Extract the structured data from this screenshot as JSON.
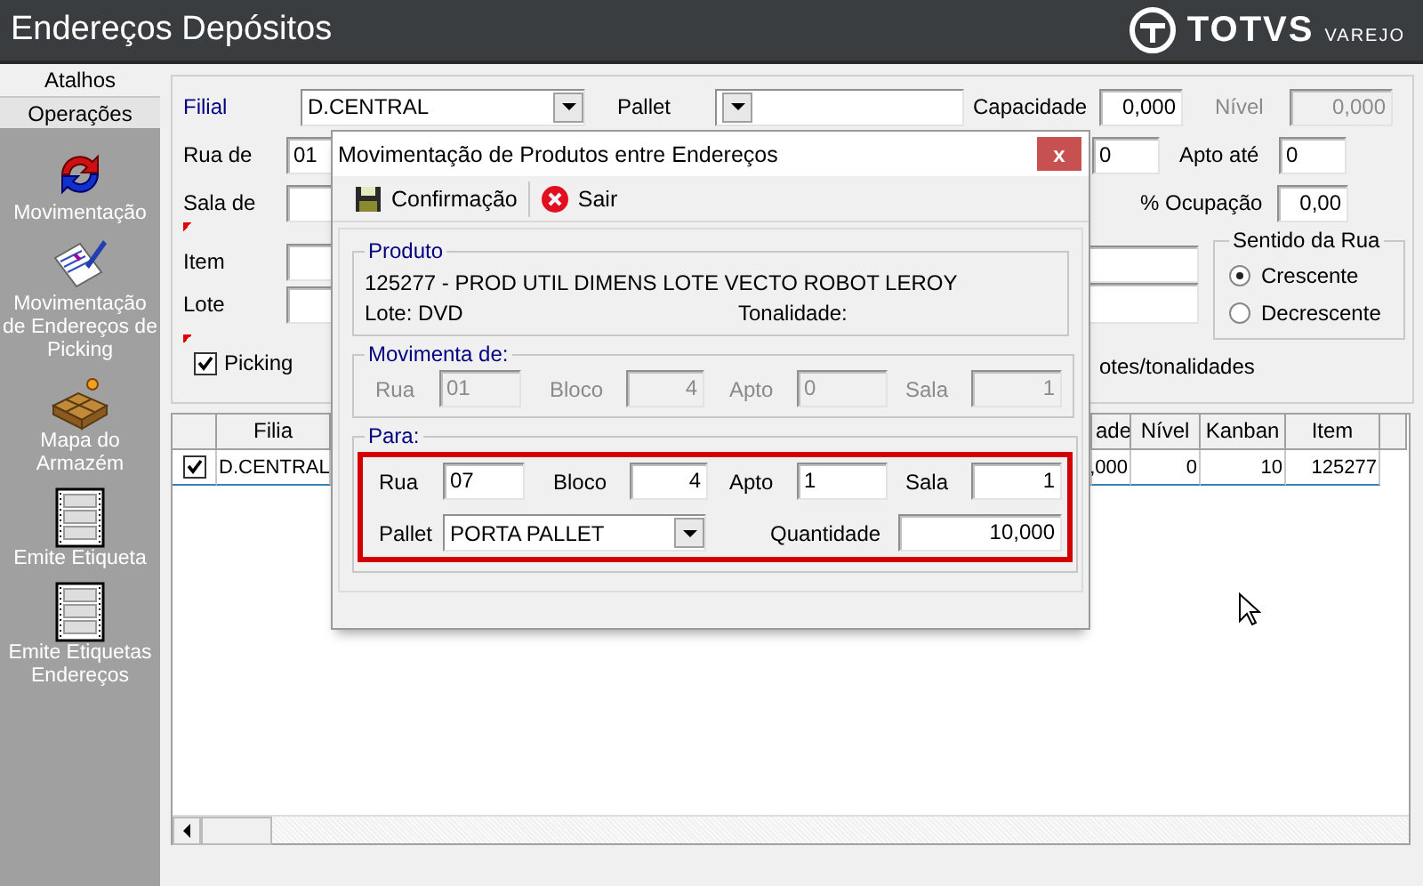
{
  "window": {
    "title": "Endereços Depósitos"
  },
  "logo": {
    "brand": "TOTVS",
    "product": "VAREJO"
  },
  "sidebar": {
    "tabs": [
      {
        "label": "Atalhos",
        "selected": false
      },
      {
        "label": "Operações",
        "selected": true
      }
    ],
    "items": [
      {
        "label": "Movimentação",
        "kind": "rotate"
      },
      {
        "label": "Movimentação de Endereços de Picking",
        "kind": "document"
      },
      {
        "label": "Mapa do Armazém",
        "kind": "boxes"
      },
      {
        "label": "Emite Etiqueta",
        "kind": "labels"
      },
      {
        "label": "Emite Etiquetas Endereços",
        "kind": "labels"
      }
    ]
  },
  "filter": {
    "filial": {
      "label": "Filial",
      "value": "D.CENTRAL"
    },
    "pallet": {
      "label": "Pallet"
    },
    "capacidade": {
      "label": "Capacidade",
      "value": "0,000"
    },
    "nivel": {
      "label": "Nível",
      "value": "0,000",
      "disabled": true
    },
    "rua_de": {
      "label": "Rua de",
      "value": "01"
    },
    "field_row_2": {
      "value": "0"
    },
    "apto_ate": {
      "label": "Apto até",
      "value": "0"
    },
    "sala_de": {
      "label": "Sala de"
    },
    "ocupacao": {
      "label": "% Ocupação",
      "value": "0,00"
    },
    "item": {
      "label": "Item",
      "required": true
    },
    "lote": {
      "label": "Lote"
    },
    "sentido_da_rua": {
      "title": "Sentido da Rua",
      "options": [
        {
          "label": "Crescente",
          "selected": true
        },
        {
          "label": "Decrescente",
          "selected": false
        }
      ]
    },
    "picking": {
      "label": "Picking",
      "checked": true,
      "required": true
    },
    "text_fragment": "otes/tonalidades"
  },
  "grid": {
    "columns": [
      "Filia",
      "ade",
      "Nível",
      "Kanban",
      "Item"
    ],
    "rows": [
      {
        "checked": true,
        "cells": [
          "D.CENTRAL",
          ",000",
          "0",
          "10",
          "125277"
        ]
      }
    ]
  },
  "dialog": {
    "title": "Movimentação de Produtos entre Endereços",
    "close": "x",
    "toolbar": [
      {
        "label": "Confirmação",
        "kind": "save"
      },
      {
        "label": "Sair",
        "kind": "exit"
      }
    ],
    "produto": {
      "title": "Produto",
      "description": "125277 - PROD UTIL DIMENS LOTE VECTO ROBOT LEROY",
      "lote_label": "Lote:",
      "lote_value": "DVD",
      "tonalidade_label": "Tonalidade:"
    },
    "movimenta_de": {
      "title": "Movimenta de:",
      "disabled": true,
      "rua": {
        "label": "Rua",
        "value": "01"
      },
      "bloco": {
        "label": "Bloco",
        "value": "4"
      },
      "apto": {
        "label": "Apto",
        "value": "0"
      },
      "sala": {
        "label": "Sala",
        "value": "1"
      }
    },
    "para": {
      "title": "Para:",
      "highlighted": true,
      "rua": {
        "label": "Rua",
        "value": "07"
      },
      "bloco": {
        "label": "Bloco",
        "value": "4"
      },
      "apto": {
        "label": "Apto",
        "value": "1"
      },
      "sala": {
        "label": "Sala",
        "value": "1"
      },
      "pallet": {
        "label": "Pallet",
        "value": "PORTA PALLET"
      },
      "quantidade": {
        "label": "Quantidade",
        "value": "10,000"
      }
    }
  }
}
